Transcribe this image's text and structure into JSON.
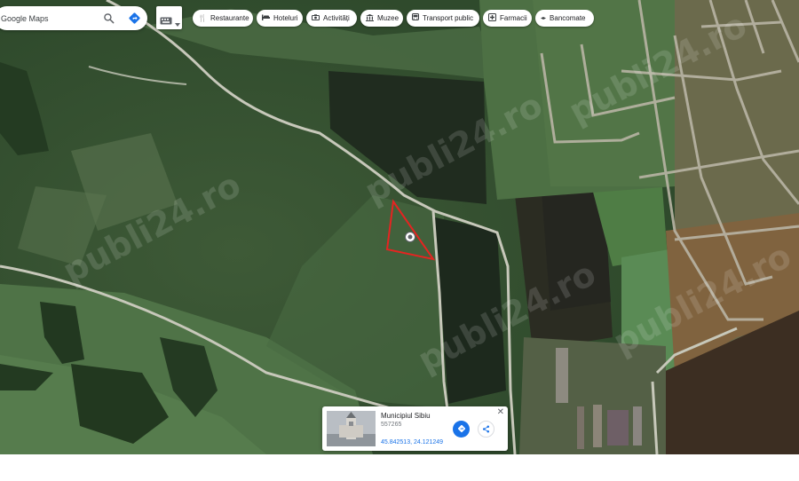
{
  "search": {
    "placeholder": "Google Maps"
  },
  "chips": [
    {
      "label": "Restaurante",
      "icon": "fork-knife-icon"
    },
    {
      "label": "Hoteluri",
      "icon": "bed-icon"
    },
    {
      "label": "Activități",
      "icon": "camera-icon"
    },
    {
      "label": "Muzee",
      "icon": "museum-icon"
    },
    {
      "label": "Transport public",
      "icon": "bus-icon"
    },
    {
      "label": "Farmacii",
      "icon": "pharmacy-icon"
    },
    {
      "label": "Bancomate",
      "icon": "atm-icon"
    }
  ],
  "place_card": {
    "title": "Municipiul Sibiu",
    "subtitle": "557265",
    "coordinates": "45.842513, 24.121249"
  },
  "map": {
    "view": "satellite",
    "watermark": "publi24.ro",
    "boundary_color": "#e52421"
  }
}
